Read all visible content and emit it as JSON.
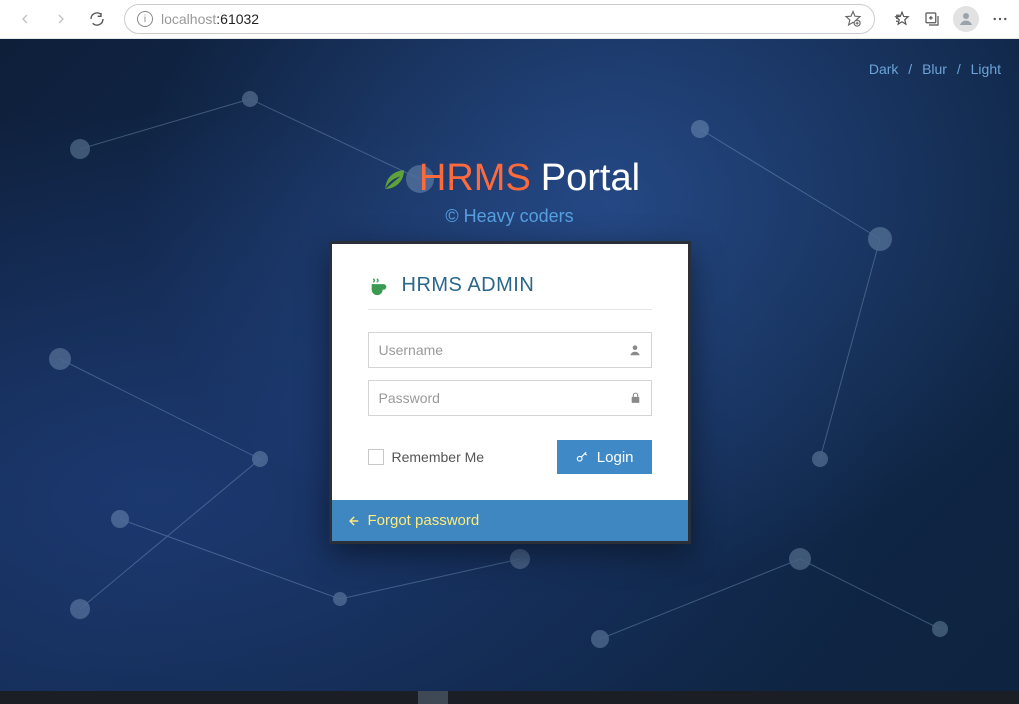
{
  "browser": {
    "url_host": "localhost",
    "url_port": ":61032"
  },
  "theme": {
    "dark": "Dark",
    "blur": "Blur",
    "light": "Light"
  },
  "brand": {
    "hrms": "HRMS",
    "portal": "Portal",
    "subtitle": "© Heavy coders"
  },
  "login": {
    "title": "HRMS ADMIN",
    "username_placeholder": "Username",
    "password_placeholder": "Password",
    "remember_label": "Remember Me",
    "login_button": "Login",
    "forgot_label": "Forgot password"
  },
  "colors": {
    "accent_orange": "#ff6a3c",
    "accent_blue": "#4089c7",
    "accent_green": "#3a9a51",
    "link_yellow": "#ffea7a"
  }
}
